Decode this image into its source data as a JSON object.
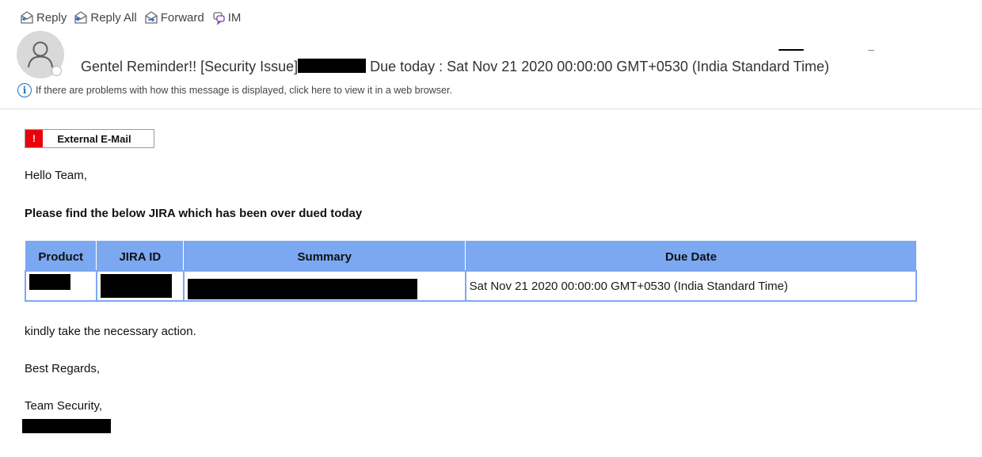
{
  "toolbar": {
    "reply": "Reply",
    "reply_all": "Reply All",
    "forward": "Forward",
    "im": "IM"
  },
  "message": {
    "subject_prefix": "Gentel Reminder!! [Security Issue]",
    "subject_suffix": " Due today  : Sat Nov 21 2020 00:00:00 GMT+0530 (India Standard Time)",
    "info_bar": "If there are problems with how this message is displayed, click here to view it in a web browser."
  },
  "badge": {
    "mark": "!",
    "label": "External E-Mail"
  },
  "body": {
    "greeting": "Hello Team,",
    "intro": "Please find the below JIRA which has been over dued today",
    "action": "kindly take the necessary action.",
    "regards": "Best Regards,",
    "signature": "Team Security,"
  },
  "table": {
    "headers": [
      "Product",
      "JIRA ID",
      "Summary",
      "Due Date"
    ],
    "rows": [
      {
        "product": "",
        "jira_id": "",
        "summary": "",
        "due_date": "Sat Nov 21 2020 00:00:00 GMT+0530 (India Standard Time)"
      }
    ]
  },
  "colors": {
    "header_bg": "#7ca8f2",
    "badge_red": "#e8000b",
    "info_blue": "#1a73c8"
  }
}
